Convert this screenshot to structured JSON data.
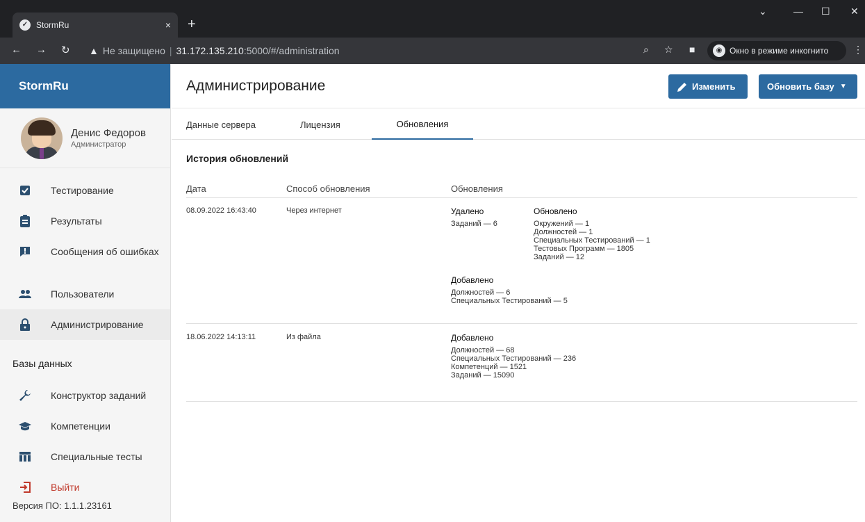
{
  "browser": {
    "tab_title": "StormRu",
    "tab_close": "×",
    "new_tab": "+",
    "not_secure": "Не защищено",
    "url_host": "31.172.135.210",
    "url_rest": ":5000/#/administration",
    "incognito": "Окно в режиме инкогнито"
  },
  "sidebar": {
    "brand": "StormRu",
    "user_name": "Денис Федоров",
    "user_role": "Администратор",
    "menu": [
      {
        "label": "Тестирование",
        "icon": "checkbox-icon"
      },
      {
        "label": "Результаты",
        "icon": "clipboard-icon"
      },
      {
        "label": "Сообщения об ошибках",
        "icon": "error-report-icon"
      },
      {
        "label": "Пользователи",
        "icon": "users-icon"
      },
      {
        "label": "Администрирование",
        "icon": "lock-icon"
      }
    ],
    "databases_title": "Базы данных",
    "db_menu": [
      {
        "label": "Конструктор заданий",
        "icon": "wrench-icon"
      },
      {
        "label": "Компетенции",
        "icon": "graduation-cap-icon"
      },
      {
        "label": "Специальные тесты",
        "icon": "table-icon"
      }
    ],
    "logout": "Выйти",
    "version": "Версия ПО: 1.1.1.23161"
  },
  "header": {
    "title": "Администрирование",
    "edit_button": "Изменить",
    "update_button": "Обновить базу"
  },
  "tabs": [
    "Данные сервера",
    "Лицензия",
    "Обновления"
  ],
  "history": {
    "title": "История обновлений",
    "columns": [
      "Дата",
      "Способ обновления",
      "Обновления"
    ],
    "rows": [
      {
        "date": "08.09.2022 16:43:40",
        "method": "Через интернет",
        "deleted_title": "Удалено",
        "deleted": [
          "Заданий — 6"
        ],
        "updated_title": "Обновлено",
        "updated": [
          "Окружений — 1",
          "Должностей — 1",
          "Специальных Тестирований — 1",
          "Тестовых Программ — 1805",
          "Заданий — 12"
        ],
        "added_title": "Добавлено",
        "added": [
          "Должностей — 6",
          "Специальных Тестирований — 5"
        ]
      },
      {
        "date": "18.06.2022 14:13:11",
        "method": "Из файла",
        "added_title": "Добавлено",
        "added": [
          "Должностей — 68",
          "Специальных Тестирований — 236",
          "Компетенций — 1521",
          "Заданий — 15090"
        ]
      }
    ]
  },
  "colors": {
    "brand": "#2c6aa0",
    "logout": "#c0392b"
  }
}
